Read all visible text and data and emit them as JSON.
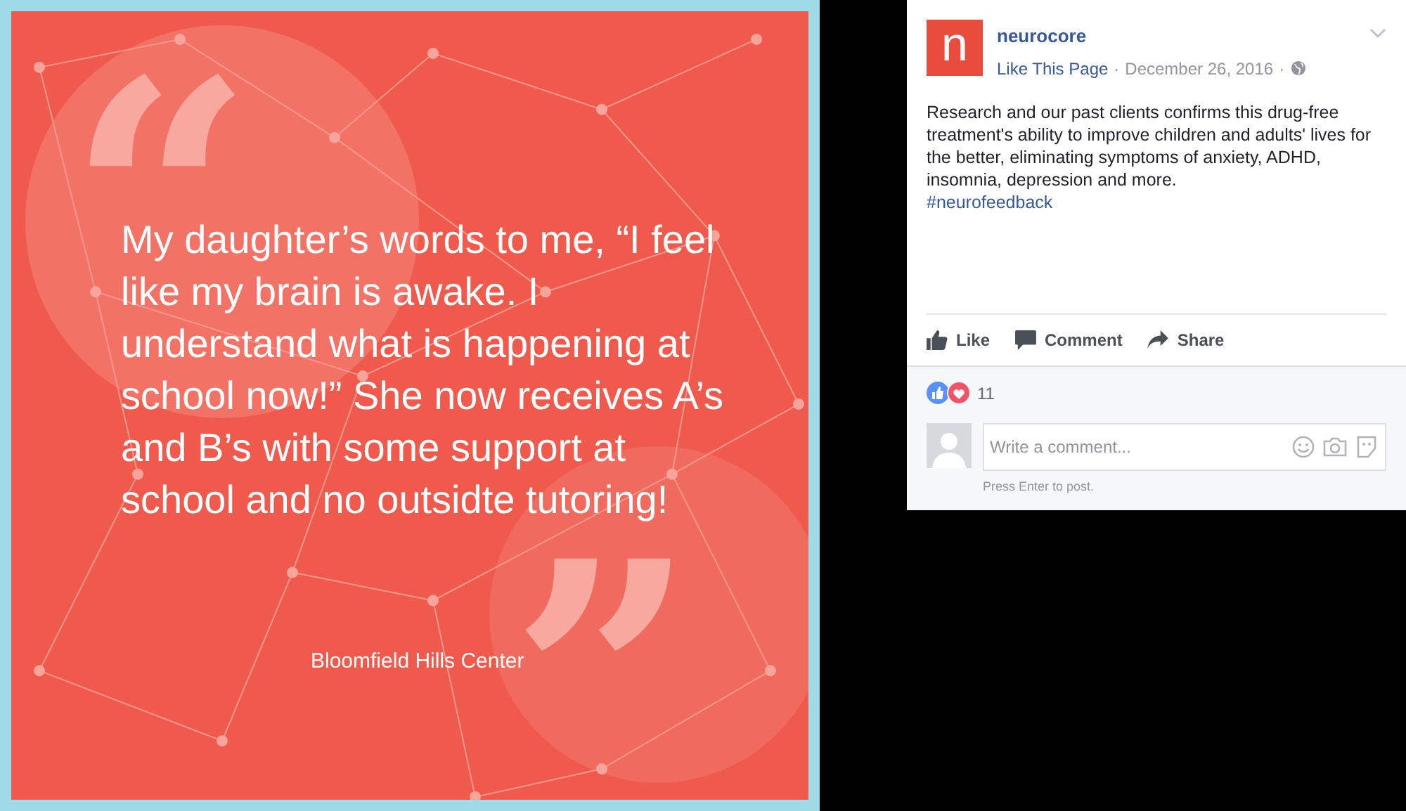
{
  "image_card": {
    "open_quote": "“",
    "quote": "My daughter’s words to me, “I feel like my brain is awake. I understand what is happening at school now!” She now receives A’s and B’s with some support at school and no outsidte tutoring!",
    "close_quote": "”",
    "caption": "Bloomfield Hills Center"
  },
  "post": {
    "page_name": "neurocore",
    "logo_letter": "n",
    "like_page": "Like This Page",
    "separator": "·",
    "date": "December 26, 2016",
    "body": "Research and our past clients confirms this drug-free treatment's ability to improve children and adults' lives for the better, eliminating symptoms of anxiety, ADHD, insomnia, depression and more.",
    "hashtag": "#neurofeedback"
  },
  "actions": [
    {
      "kind": "like",
      "label": "Like"
    },
    {
      "kind": "comment",
      "label": "Comment"
    },
    {
      "kind": "share",
      "label": "Share"
    }
  ],
  "reactions": {
    "count": "11"
  },
  "comment_box": {
    "placeholder": "Write a comment...",
    "hint": "Press Enter to post."
  }
}
